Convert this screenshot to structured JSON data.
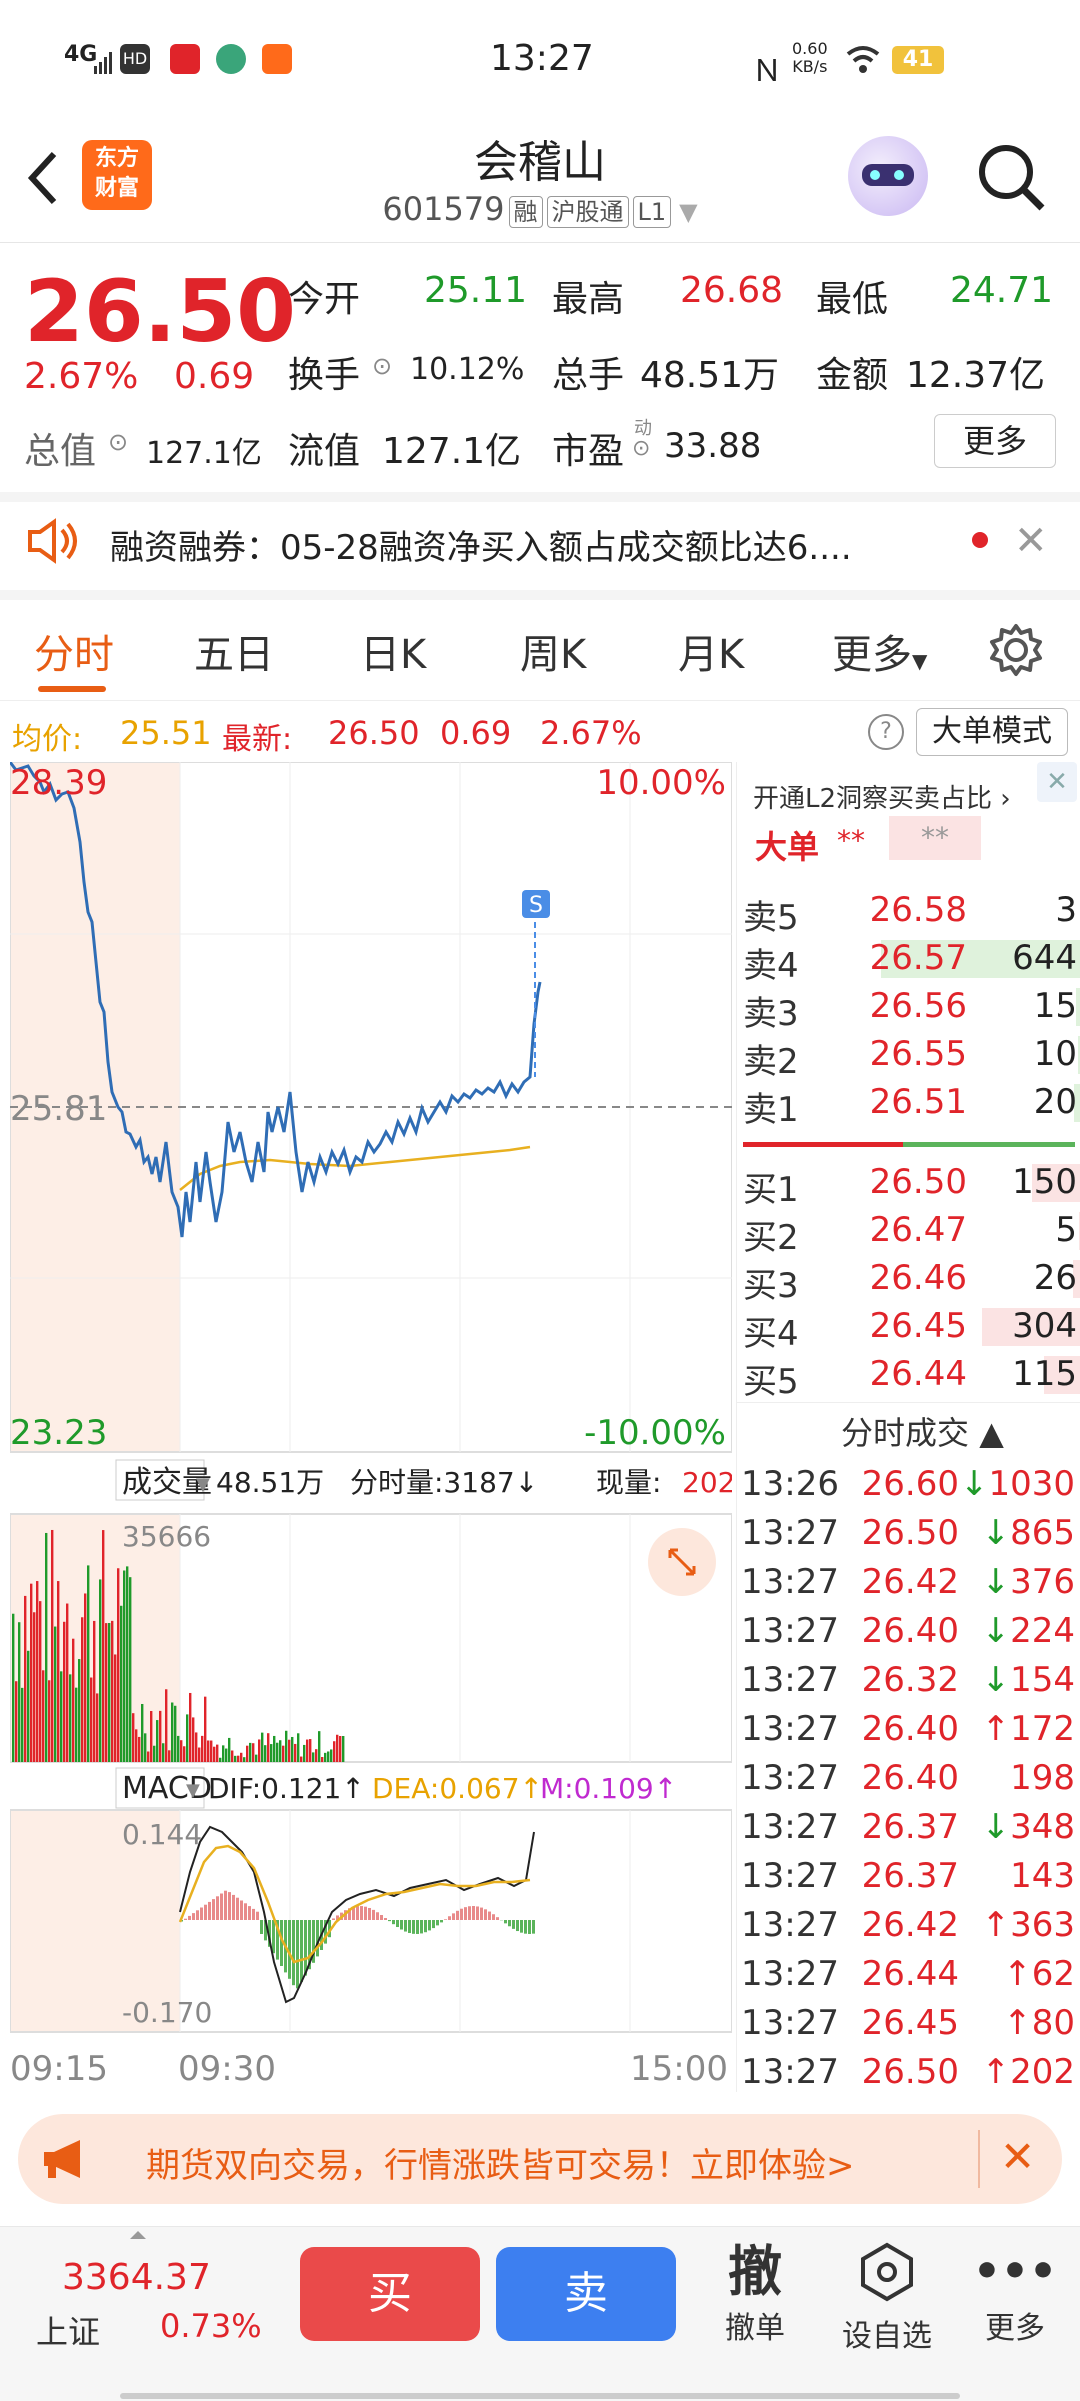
{
  "status_bar": {
    "time": "13:27",
    "network": "4G",
    "net_speed_top": "0.60",
    "net_speed_unit": "KB/s",
    "battery": "41"
  },
  "header": {
    "logo_line1": "东方",
    "logo_line2": "财富",
    "title": "会稽山",
    "code": "601579",
    "tag_rong": "融",
    "tag_hgt": "沪股通",
    "tag_l1": "L1"
  },
  "quote": {
    "price": "26.50",
    "change_pct": "2.67%",
    "change_amt": "0.69",
    "open_label": "今开",
    "open": "25.11",
    "high_label": "最高",
    "high": "26.68",
    "low_label": "最低",
    "low": "24.71",
    "turnover_label": "换手",
    "turnover": "10.12%",
    "volume_label": "总手",
    "volume": "48.51万",
    "amount_label": "金额",
    "amount": "12.37亿",
    "mcap_label": "总值",
    "mcap": "127.1亿",
    "float_label": "流值",
    "float_mcap": "127.1亿",
    "pe_label": "市盈",
    "pe_sup": "动",
    "pe": "33.88",
    "more": "更多"
  },
  "notice": {
    "text": "融资融券：05-28融资净买入额占成交额比达6...."
  },
  "tabs": [
    "分时",
    "五日",
    "日K",
    "周K",
    "月K",
    "更多"
  ],
  "info": {
    "avg_label": "均价:",
    "avg": "25.51",
    "latest_label": "最新:",
    "latest": "26.50",
    "chg": "0.69",
    "pct": "2.67%",
    "mode_btn": "大单模式"
  },
  "chart": {
    "max_price": "28.39",
    "min_price": "23.23",
    "base": "25.81",
    "max_pct": "10.00%",
    "min_pct": "-10.00%",
    "s_marker": "S",
    "vol_label": "成交量",
    "vol_total": "48.51万",
    "vol_min": "分时量:3187",
    "vol_now_label": "现量:",
    "vol_now": "202",
    "vol_max": "35666",
    "macd_label": "MACD",
    "dif": "DIF:0.121",
    "dea": "DEA:0.067",
    "m": "M:0.109",
    "macd_max": "0.144",
    "macd_min": "-0.170",
    "t0": "09:15",
    "t1": "09:30",
    "t2": "15:00"
  },
  "book": {
    "l2_link": "开通L2洞察买卖占比",
    "big_label": "大单",
    "big_val1": "**",
    "big_val2": "**",
    "sells": [
      {
        "label": "卖5",
        "price": "26.58",
        "vol": "3"
      },
      {
        "label": "卖4",
        "price": "26.57",
        "vol": "644"
      },
      {
        "label": "卖3",
        "price": "26.56",
        "vol": "15"
      },
      {
        "label": "卖2",
        "price": "26.55",
        "vol": "10"
      },
      {
        "label": "卖1",
        "price": "26.51",
        "vol": "20"
      }
    ],
    "buys": [
      {
        "label": "买1",
        "price": "26.50",
        "vol": "150"
      },
      {
        "label": "买2",
        "price": "26.47",
        "vol": "5"
      },
      {
        "label": "买3",
        "price": "26.46",
        "vol": "26"
      },
      {
        "label": "买4",
        "price": "26.45",
        "vol": "304"
      },
      {
        "label": "买5",
        "price": "26.44",
        "vol": "115"
      }
    ],
    "ticks_header": "分时成交",
    "ticks": [
      {
        "t": "13:26",
        "p": "26.60",
        "a": "↓",
        "v": "1030"
      },
      {
        "t": "13:27",
        "p": "26.50",
        "a": "↓",
        "v": "865"
      },
      {
        "t": "13:27",
        "p": "26.42",
        "a": "↓",
        "v": "376"
      },
      {
        "t": "13:27",
        "p": "26.40",
        "a": "↓",
        "v": "224"
      },
      {
        "t": "13:27",
        "p": "26.32",
        "a": "↓",
        "v": "154"
      },
      {
        "t": "13:27",
        "p": "26.40",
        "a": "↑",
        "v": "172"
      },
      {
        "t": "13:27",
        "p": "26.40",
        "a": "",
        "v": "198"
      },
      {
        "t": "13:27",
        "p": "26.37",
        "a": "↓",
        "v": "348"
      },
      {
        "t": "13:27",
        "p": "26.37",
        "a": "",
        "v": "143"
      },
      {
        "t": "13:27",
        "p": "26.42",
        "a": "↑",
        "v": "363"
      },
      {
        "t": "13:27",
        "p": "26.44",
        "a": "↑",
        "v": "62"
      },
      {
        "t": "13:27",
        "p": "26.45",
        "a": "↑",
        "v": "80"
      },
      {
        "t": "13:27",
        "p": "26.50",
        "a": "↑",
        "v": "202"
      }
    ]
  },
  "promo": {
    "text": "期货双向交易，行情涨跌皆可交易！立即体验>"
  },
  "bottom": {
    "index_value": "3364.37",
    "index_name": "上证",
    "index_pct": "0.73%",
    "buy": "买",
    "sell": "卖",
    "cancel_glyph": "撤",
    "cancel": "撤单",
    "watch": "设自选",
    "more": "更多"
  },
  "colors": {
    "up": "#e0242a",
    "down": "#1f9a2a",
    "accent": "#e85d14",
    "buy_btn": "#ea4a4a",
    "sell_btn": "#3d7ff0"
  }
}
